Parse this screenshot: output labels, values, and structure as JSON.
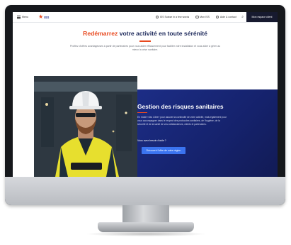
{
  "header": {
    "menu_label": "Menu",
    "logo_text": "ISS",
    "nav": [
      {
        "label": "ISS Suisse in a few words"
      },
      {
        "label": "Mon ISS"
      },
      {
        "label": "Aide & contact"
      }
    ],
    "cta_label": "Mon espace client"
  },
  "hero": {
    "title_accent": "Redémarrez",
    "title_rest": " votre activité en toute sérénité",
    "subtitle": "Profitez d'offres avantageuses à partir de partenaires pour vous aider efficacement pour faciliter votre installation et vous aider à gérer au mieux la crise sanitaire."
  },
  "feature": {
    "title": "Gestion des risques sanitaires",
    "body": "En mode «Jeu Libre» pour assurer la continuité de votre activité, mais également pour vous accompagner dans le respect des protocoles sanitaires, de l'hygiène, de la sécurité et de la santé de vos collaborateurs, clients et partenaires.",
    "question": "Vous avez besoin d'aide ?",
    "button_label": "Découvrir l'offre de votre région"
  },
  "colors": {
    "accent": "#e8491f",
    "navy": "#1e2a5c",
    "panel": "#1c2d86",
    "button": "#3b74f0",
    "bezel": "#16181c"
  }
}
